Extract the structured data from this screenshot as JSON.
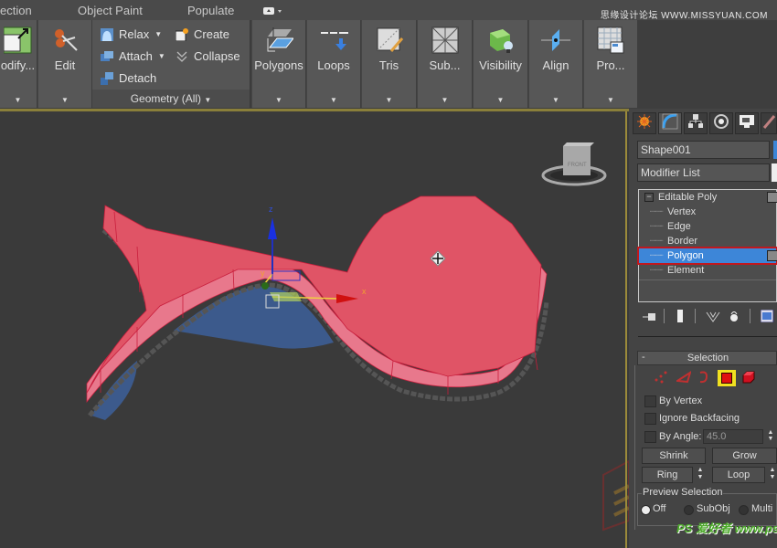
{
  "tabs": [
    {
      "label": "ection"
    },
    {
      "label": "Object Paint"
    },
    {
      "label": "Populate"
    }
  ],
  "tab_extra_icon": "camera-dropdown-icon",
  "watermark_top": "思缘设计论坛  WWW.MISSYUAN.COM",
  "ribbon": {
    "modify_label": "odify...",
    "edit_label": "Edit",
    "geometry": {
      "relax": "Relax",
      "attach": "Attach",
      "detach": "Detach",
      "create": "Create",
      "collapse": "Collapse",
      "footer": "Geometry (All)"
    },
    "buttons": [
      {
        "label": "Polygons",
        "icon": "polygons-icon"
      },
      {
        "label": "Loops",
        "icon": "loops-icon"
      },
      {
        "label": "Tris",
        "icon": "tris-icon"
      },
      {
        "label": "Sub...",
        "icon": "subdivision-icon"
      },
      {
        "label": "Visibility",
        "icon": "visibility-icon"
      },
      {
        "label": "Align",
        "icon": "align-icon"
      },
      {
        "label": "Pro...",
        "icon": "properties-icon"
      }
    ]
  },
  "viewport": {
    "viewcube_label": "FRONT",
    "gizmo": {
      "x": "x",
      "y": "y",
      "z": "z"
    },
    "colors": {
      "selected_face": "#e05060",
      "side_face": "#e8788c",
      "back_face": "#3c5a8c",
      "background": "#3a3a3a"
    }
  },
  "command_panel": {
    "object_name": "Shape001",
    "modifier_list": "Modifier List",
    "object_color": "#3d86d8",
    "stack": [
      {
        "label": "Editable Poly",
        "level": 0
      },
      {
        "label": "Vertex",
        "level": 1
      },
      {
        "label": "Edge",
        "level": 1
      },
      {
        "label": "Border",
        "level": 1
      },
      {
        "label": "Polygon",
        "level": 1,
        "selected": true
      },
      {
        "label": "Element",
        "level": 1
      }
    ],
    "selection_rollout": {
      "title": "Selection",
      "collapse": "-",
      "by_vertex": "By Vertex",
      "ignore_backfacing": "Ignore Backfacing",
      "by_angle": "By Angle:",
      "angle_value": "45.0",
      "shrink": "Shrink",
      "grow": "Grow",
      "ring": "Ring",
      "loop": "Loop",
      "preview_selection": "Preview Selection",
      "preview_options": [
        "Off",
        "SubObj",
        "Multi"
      ],
      "preview_selected": "Off"
    }
  },
  "watermark_bottom": "PS 爱好者  www.psahz.com"
}
